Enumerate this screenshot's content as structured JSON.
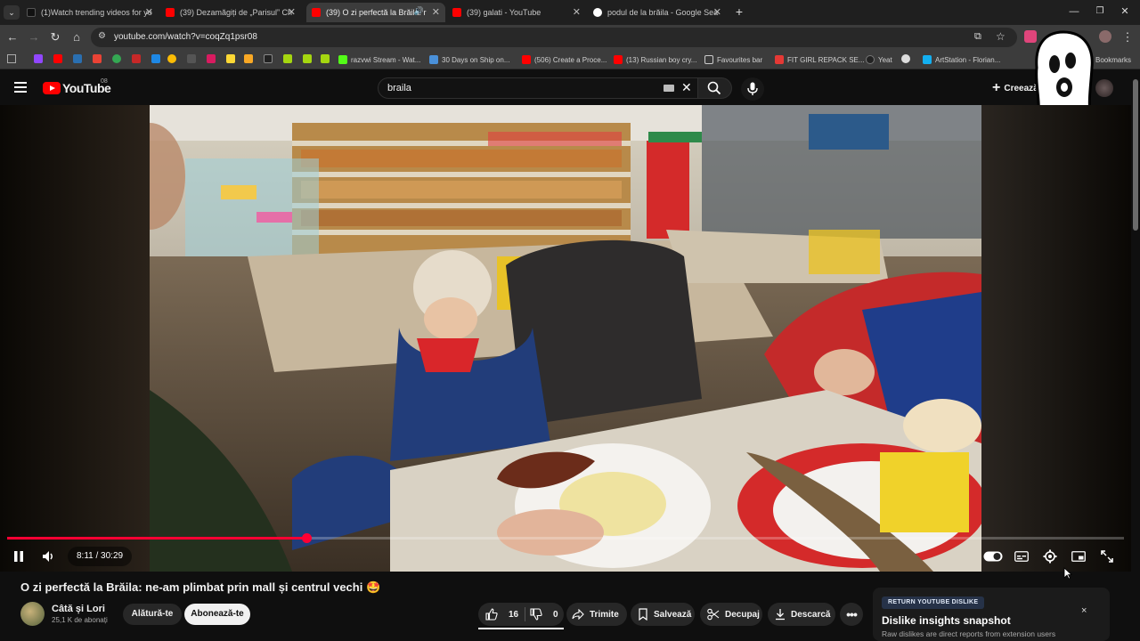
{
  "browser": {
    "tabs": [
      {
        "label": "(1)Watch trending videos for yo",
        "icon": "tiktok-icon"
      },
      {
        "label": "(39) Dezamăgiți de „Parisul” Ch",
        "icon": "youtube-icon"
      },
      {
        "label": "(39) O zi perfectă la Brăila: r",
        "icon": "youtube-icon",
        "active": true
      },
      {
        "label": "(39) galati - YouTube",
        "icon": "youtube-icon"
      },
      {
        "label": "podul de la brăila - Google Sea",
        "icon": "google-icon"
      }
    ],
    "url": "youtube.com/watch?v=coqZq1psr08",
    "bookmarks": [
      {
        "label": "razvwi Stream - Wat..."
      },
      {
        "label": "30 Days on Ship on..."
      },
      {
        "label": "(506) Create a Proce..."
      },
      {
        "label": "(13) Russian boy cry..."
      },
      {
        "label": "Favourites bar"
      },
      {
        "label": "FIT GIRL REPACK SE..."
      },
      {
        "label": "Yeat"
      },
      {
        "label": "ArtStation - Florian..."
      },
      {
        "label": "Bookmarks"
      }
    ]
  },
  "youtube": {
    "logo_text": "YouTube",
    "logo_badge": "08",
    "search_value": "braila",
    "create_label": "Creează",
    "video": {
      "current_time": "8:11",
      "duration": "30:29",
      "time_display": "8:11 / 30:29",
      "progress_fraction": 0.268,
      "title": "O zi perfectă la Brăila: ne-am plimbat prin mall și centrul vechi 🤩"
    },
    "channel": {
      "name": "Câtă și Lori",
      "subscribers": "25,1 K de abonați",
      "join_label": "Alătură-te",
      "subscribe_label": "Abonează-te"
    },
    "actions": {
      "likes": "16",
      "dislikes": "0",
      "share_label": "Trimite",
      "save_label": "Salvează",
      "clip_label": "Decupaj",
      "download_label": "Descarcă"
    },
    "ryd": {
      "badge": "RETURN YOUTUBE DISLIKE",
      "title": "Dislike insights snapshot",
      "subtitle": "Raw dislikes are direct reports from extension users",
      "close_label": "×"
    }
  },
  "colors": {
    "accent_red": "#ff0033",
    "background": "#0f0f0f",
    "chip": "#272727"
  }
}
